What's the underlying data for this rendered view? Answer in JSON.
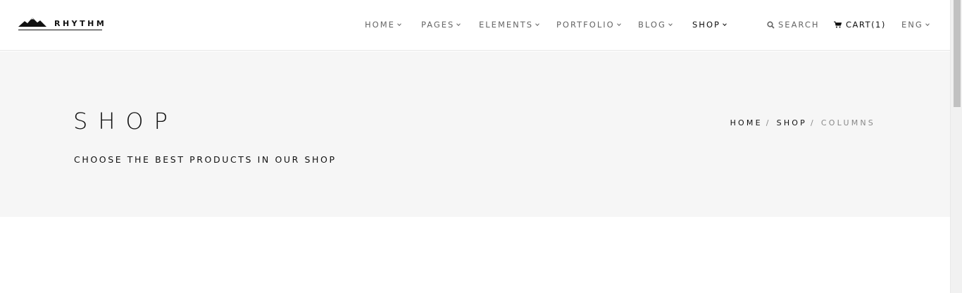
{
  "brand": {
    "name": "RHYTHM"
  },
  "nav": {
    "items": [
      {
        "label": "HOME",
        "active": false
      },
      {
        "label": "PAGES",
        "active": false
      },
      {
        "label": "ELEMENTS",
        "active": false
      },
      {
        "label": "PORTFOLIO",
        "active": false
      },
      {
        "label": "BLOG",
        "active": false
      },
      {
        "label": "SHOP",
        "active": true
      }
    ],
    "search_label": "SEARCH",
    "cart_label": "CART(1)",
    "lang_label": "ENG"
  },
  "hero": {
    "title": "SHOP",
    "subtitle": "CHOOSE THE BEST PRODUCTS IN OUR SHOP",
    "breadcrumb": [
      "HOME",
      "SHOP",
      "COLUMNS"
    ]
  }
}
